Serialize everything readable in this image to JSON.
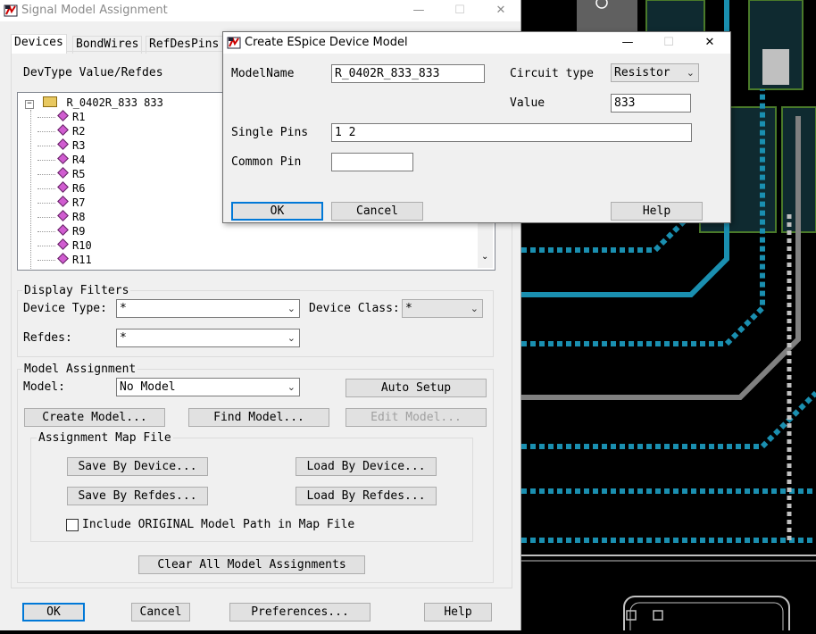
{
  "main_window": {
    "title": "Signal Model Assignment",
    "minimize": "—",
    "maximize": "☐",
    "close": "✕",
    "tabs": [
      "Devices",
      "BondWires",
      "RefDesPins"
    ],
    "devtype_header": "DevType Value/Refdes",
    "tree": {
      "root_label": "R_0402R_833 833",
      "children": [
        "R1",
        "R2",
        "R3",
        "R4",
        "R5",
        "R6",
        "R7",
        "R8",
        "R9",
        "R10",
        "R11"
      ]
    },
    "display_filters": {
      "title": "Display Filters",
      "device_type_label": "Device Type:",
      "device_type_value": "*",
      "device_class_label": "Device Class:",
      "device_class_value": "*",
      "refdes_label": "Refdes:",
      "refdes_value": "*"
    },
    "model_assignment": {
      "title": "Model Assignment",
      "model_label": "Model:",
      "model_value": "No Model",
      "auto_setup": "Auto Setup",
      "create_model": "Create Model...",
      "find_model": "Find Model...",
      "edit_model": "Edit Model..."
    },
    "assignment_map_file": {
      "title": "Assignment Map File",
      "save_by_device": "Save By Device...",
      "load_by_device": "Load By Device...",
      "save_by_refdes": "Save By Refdes...",
      "load_by_refdes": "Load By Refdes...",
      "include_original": "Include ORIGINAL Model Path in Map File"
    },
    "clear_all": "Clear All Model Assignments",
    "ok": "OK",
    "cancel": "Cancel",
    "preferences": "Preferences...",
    "help": "Help"
  },
  "dialog": {
    "title": "Create ESpice Device Model",
    "minimize": "—",
    "maximize": "☐",
    "close": "✕",
    "model_name_label": "ModelName",
    "model_name_value": "R_0402R_833_833",
    "circuit_type_label": "Circuit type",
    "circuit_type_value": "Resistor",
    "value_label": "Value",
    "value_value": "833",
    "single_pins_label": "Single Pins",
    "single_pins_value": "1 2",
    "common_pin_label": "Common Pin",
    "common_pin_value": "",
    "ok": "OK",
    "cancel": "Cancel",
    "help": "Help"
  },
  "colors": {
    "pcb_trace": "#1a8fb0",
    "pcb_gray": "#808080",
    "pcb_green": "#4a7a2a",
    "accent_focus": "#0078d7"
  }
}
